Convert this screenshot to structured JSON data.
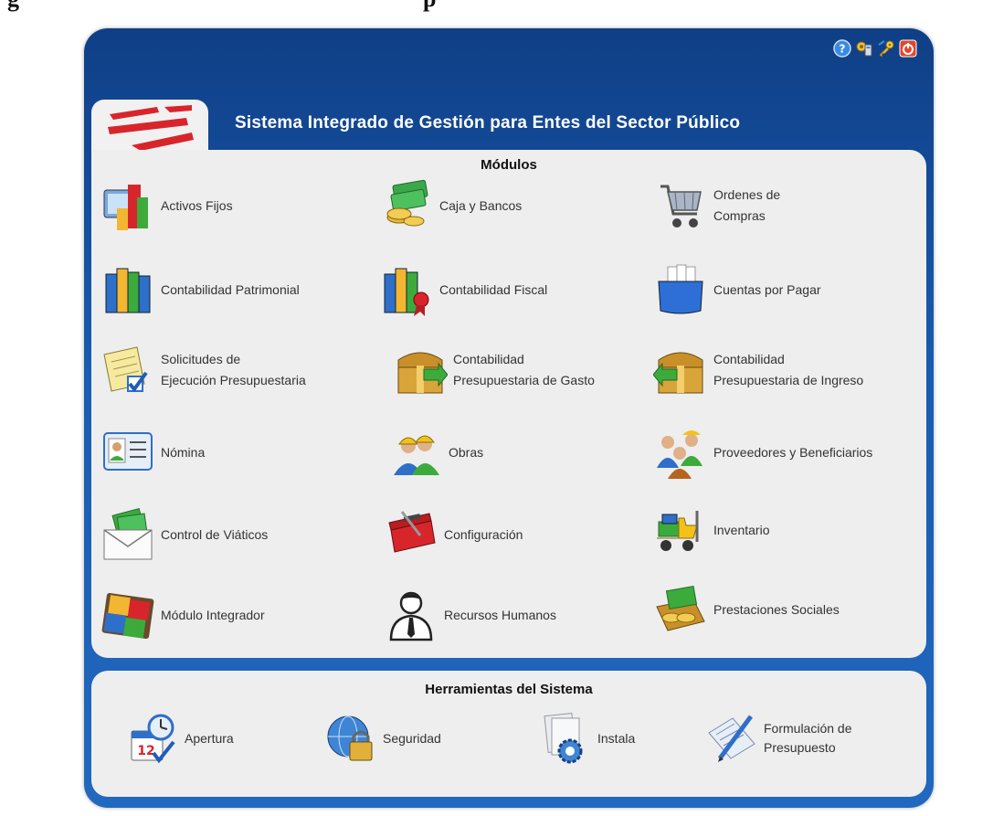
{
  "caption_cut": "g                                                                    p",
  "header": {
    "title": "Sistema Integrado de Gestión para Entes del Sector Público",
    "top_icons": [
      "help-icon",
      "settings-icon",
      "key-icon",
      "power-icon"
    ]
  },
  "modules": {
    "heading": "Módulos",
    "items": [
      {
        "label": "Activos Fijos",
        "icon": "fixed-assets-icon"
      },
      {
        "label": "Caja y Bancos",
        "icon": "cash-banks-icon"
      },
      {
        "label": "Ordenes de\nCompras",
        "icon": "shopping-cart-icon"
      },
      {
        "label": "Contabilidad Patrimonial",
        "icon": "books-icon"
      },
      {
        "label": "Contabilidad Fiscal",
        "icon": "books-ribbon-icon"
      },
      {
        "label": "Cuentas por Pagar",
        "icon": "file-box-icon"
      },
      {
        "label": "Solicitudes de\nEjecución Presupuestaria",
        "icon": "checklist-icon"
      },
      {
        "label": "Contabilidad\nPresupuestaria de Gasto",
        "icon": "treasure-chest-out-icon"
      },
      {
        "label": "Contabilidad\nPresupuestaria  de Ingreso",
        "icon": "treasure-chest-in-icon"
      },
      {
        "label": "Nómina",
        "icon": "id-card-icon"
      },
      {
        "label": "Obras",
        "icon": "workers-icon"
      },
      {
        "label": "Proveedores y Beneficiarios",
        "icon": "people-group-icon"
      },
      {
        "label": "Control de Viáticos",
        "icon": "money-envelope-icon"
      },
      {
        "label": "Configuración",
        "icon": "toolbox-icon"
      },
      {
        "label": "Inventario",
        "icon": "forklift-icon"
      },
      {
        "label": "Módulo Integrador",
        "icon": "puzzle-icon"
      },
      {
        "label": "Recursos Humanos",
        "icon": "person-icon"
      },
      {
        "label": "Prestaciones Sociales",
        "icon": "money-book-icon"
      }
    ]
  },
  "tools": {
    "heading": "Herramientas del Sistema",
    "items": [
      {
        "label": "Apertura",
        "icon": "calendar-clock-icon"
      },
      {
        "label": "Seguridad",
        "icon": "globe-lock-icon"
      },
      {
        "label": "Instala",
        "icon": "document-gear-icon"
      },
      {
        "label": "Formulación de\nPresupuesto",
        "icon": "pen-document-icon"
      }
    ]
  }
}
